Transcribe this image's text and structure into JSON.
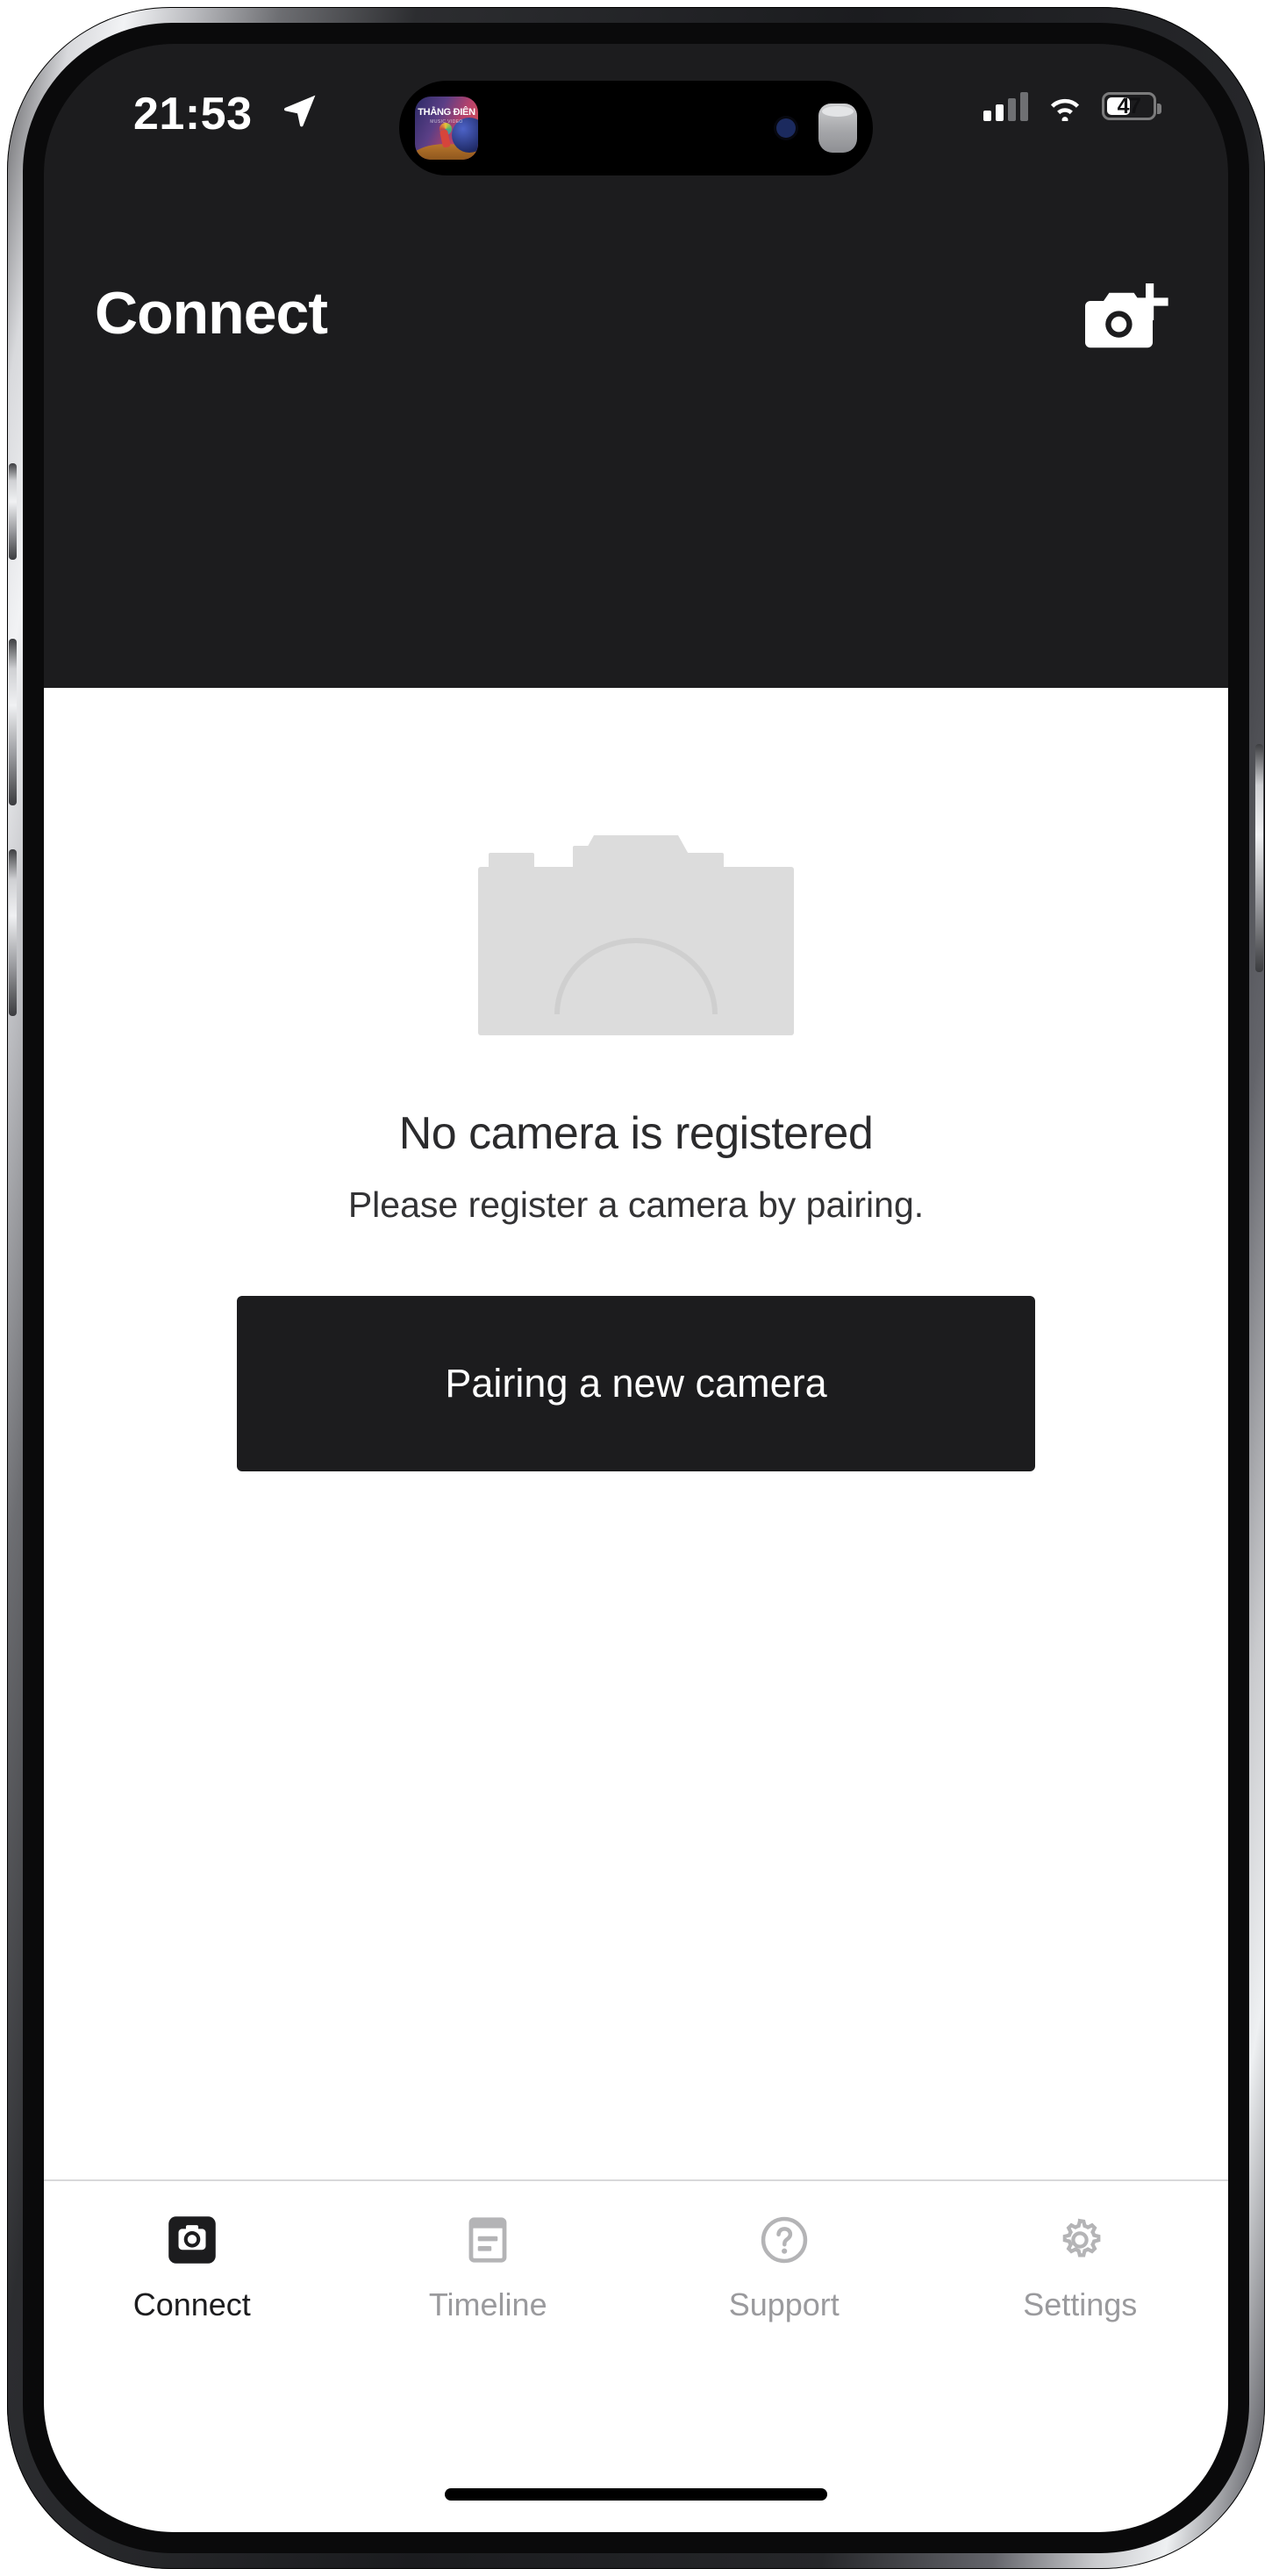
{
  "status_bar": {
    "time": "21:53",
    "location_icon": "location-arrow-icon",
    "signal_icon": "cellular-signal-icon",
    "wifi_icon": "wifi-icon",
    "battery_percent": "47",
    "battery_level": 47
  },
  "dynamic_island": {
    "app_icon_title": "THẰNG ĐIÊN",
    "app_icon_subtitle": "MUSIC VIDEO",
    "left_icon": "album-art-icon",
    "center_icon": "face-id-camera-icon",
    "right_icon": "homepod-icon"
  },
  "app_bar": {
    "title": "Connect",
    "action_icon": "add-camera-icon"
  },
  "content": {
    "illustration_icon": "camera-placeholder-icon",
    "title": "No camera is registered",
    "subtitle": "Please register a camera by pairing.",
    "primary_button_label": "Pairing a new camera"
  },
  "tab_bar": {
    "active_index": 0,
    "tabs": [
      {
        "label": "Connect",
        "icon": "camera-icon"
      },
      {
        "label": "Timeline",
        "icon": "document-list-icon"
      },
      {
        "label": "Support",
        "icon": "question-circle-icon"
      },
      {
        "label": "Settings",
        "icon": "gear-icon"
      }
    ]
  },
  "colors": {
    "header_bg": "#1c1c1e",
    "content_bg": "#ffffff",
    "button_bg": "#1c1c1e",
    "inactive_tab": "#9a9a9d",
    "active_tab": "#1c1c1e",
    "placeholder_gray": "#dcdcdc"
  }
}
